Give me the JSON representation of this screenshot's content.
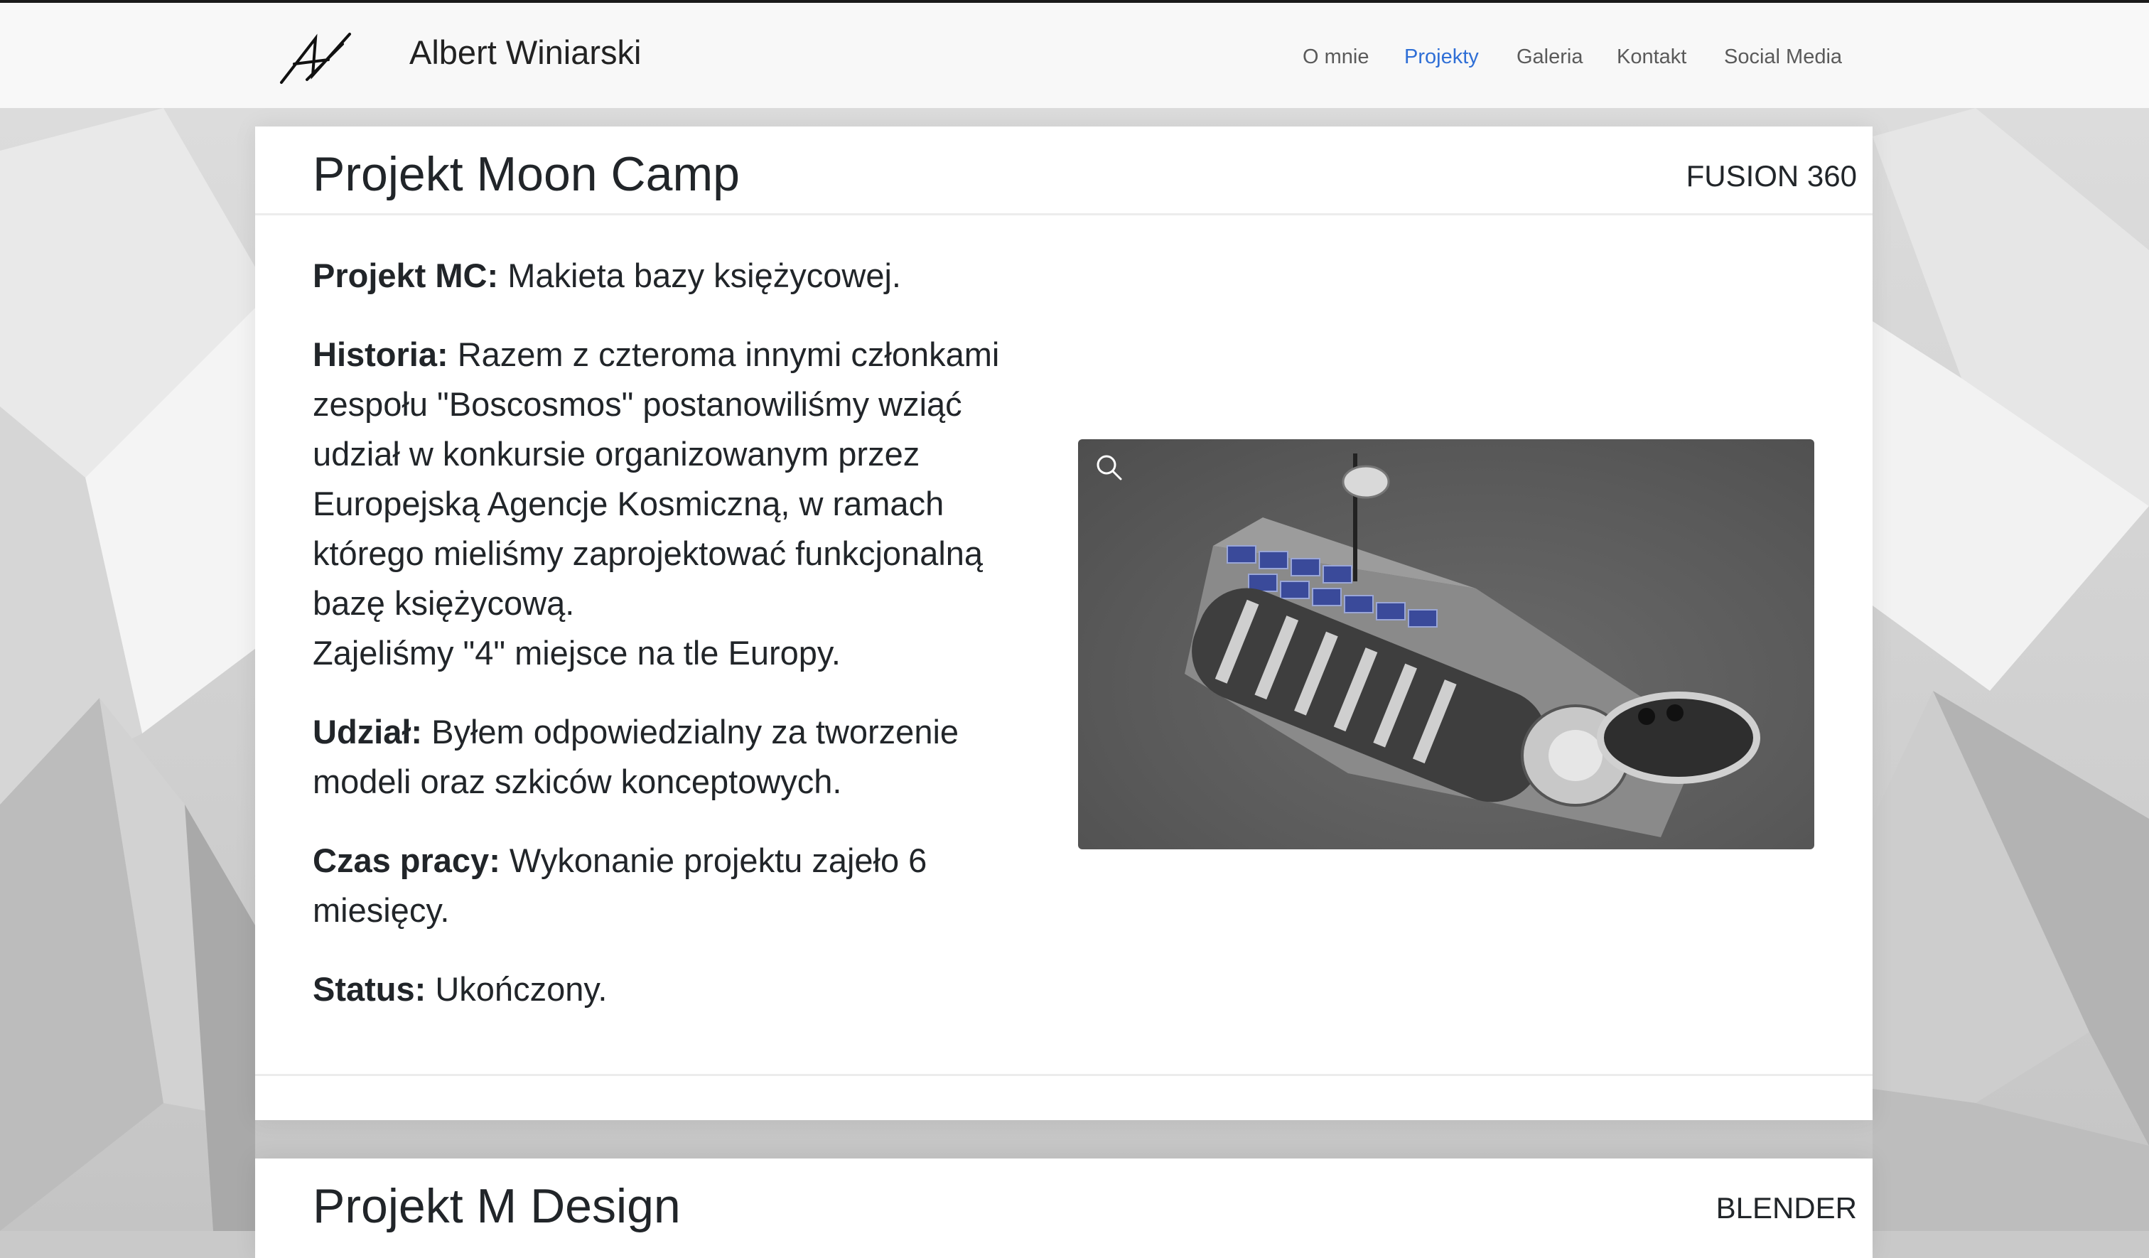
{
  "brand": {
    "name": "Albert Winiarski"
  },
  "nav": {
    "items": [
      "O mnie",
      "Projekty",
      "Galeria",
      "Kontakt",
      "Social Media"
    ],
    "active": "Projekty"
  },
  "projects": [
    {
      "title": "Projekt Moon Camp",
      "tool": "FUSION 360",
      "paragraphs": [
        {
          "label": "Projekt MC:",
          "text": " Makieta bazy księżycowej."
        },
        {
          "label": "Historia:",
          "text": " Razem z czteroma innymi członkami zespołu \"Boscosmos\" postanowiliśmy wziąć udział w konkursie organizowanym przez Europejską Agencje Kosmiczną, w ramach którego mieliśmy zaprojektować funkcjonalną bazę księżycową.",
          "extra": "Zajeliśmy \"4\" miejsce na tle Europy."
        },
        {
          "label": "Udział:",
          "text": " Byłem odpowiedzialny za tworzenie modeli oraz szkiców konceptowych."
        },
        {
          "label": "Czas pracy:",
          "text": " Wykonanie projektu zajeło 6 miesięcy."
        },
        {
          "label": "Status:",
          "text": " Ukończony."
        }
      ],
      "image": {
        "icon": "magnifier-icon",
        "subject": "moon-base-model"
      }
    },
    {
      "title": "Projekt M Design",
      "tool": "BLENDER"
    }
  ],
  "colors": {
    "accent": "#2f6fd6",
    "navbar": "#f8f8f8"
  }
}
